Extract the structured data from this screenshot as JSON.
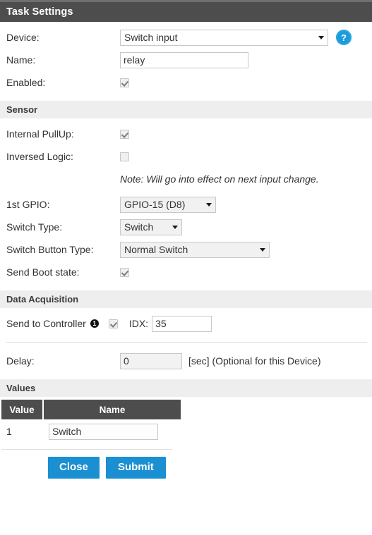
{
  "panel": {
    "title": "Task Settings"
  },
  "task": {
    "device_label": "Device:",
    "device_value": "Switch input",
    "help_icon": "question-mark-icon",
    "name_label": "Name:",
    "name_value": "relay",
    "enabled_label": "Enabled:",
    "enabled_checked": true
  },
  "sensor": {
    "section_title": "Sensor",
    "internal_pullup_label": "Internal PullUp:",
    "internal_pullup_checked": true,
    "inversed_logic_label": "Inversed Logic:",
    "inversed_logic_checked": false,
    "note": "Note: Will go into effect on next input change.",
    "gpio_label": "1st GPIO:",
    "gpio_value": "GPIO-15 (D8)",
    "switch_type_label": "Switch Type:",
    "switch_type_value": "Switch",
    "switch_button_type_label": "Switch Button Type:",
    "switch_button_type_value": "Normal Switch",
    "send_boot_state_label": "Send Boot state:",
    "send_boot_state_checked": true
  },
  "data_acquisition": {
    "section_title": "Data Acquisition",
    "send_to_controller_label": "Send to Controller",
    "controller_badge": "1",
    "send_to_controller_checked": true,
    "idx_label": "IDX:",
    "idx_value": "35",
    "delay_label": "Delay:",
    "delay_value": "0",
    "delay_suffix": "[sec] (Optional for this Device)"
  },
  "values": {
    "section_title": "Values",
    "columns": [
      "Value",
      "Name"
    ],
    "rows": [
      {
        "value": "1",
        "name": "Switch"
      }
    ]
  },
  "buttons": {
    "close": "Close",
    "submit": "Submit"
  },
  "colors": {
    "header_bg": "#4d4d4d",
    "accent_button": "#1a8fd1",
    "help_icon": "#1a9bdb",
    "section_bg": "#eeeeee"
  }
}
